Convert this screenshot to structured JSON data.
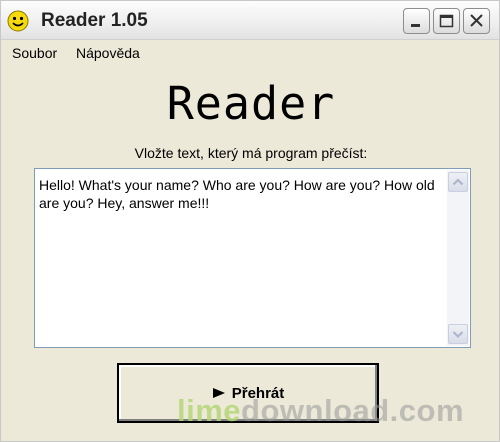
{
  "window": {
    "title": "Reader 1.05",
    "icon": "smiley-icon"
  },
  "titlebar_buttons": [
    "minimize-icon",
    "maximize-icon",
    "close-icon"
  ],
  "menu": {
    "items": [
      "Soubor",
      "Nápověda"
    ]
  },
  "main": {
    "heading": "Reader",
    "prompt": "Vložte text, který má program přečíst:",
    "text_value": "Hello! What's your name? Who are you? How are you? How old are you? Hey, answer me!!!",
    "play_button": {
      "icon": "play-icon",
      "label": "Přehrát"
    }
  },
  "watermark": {
    "part1": "lime",
    "part2": "download.com"
  },
  "colors": {
    "window_bg": "#ece9d8",
    "textarea_border": "#7f9db9",
    "watermark_green": "#b5d77a"
  }
}
